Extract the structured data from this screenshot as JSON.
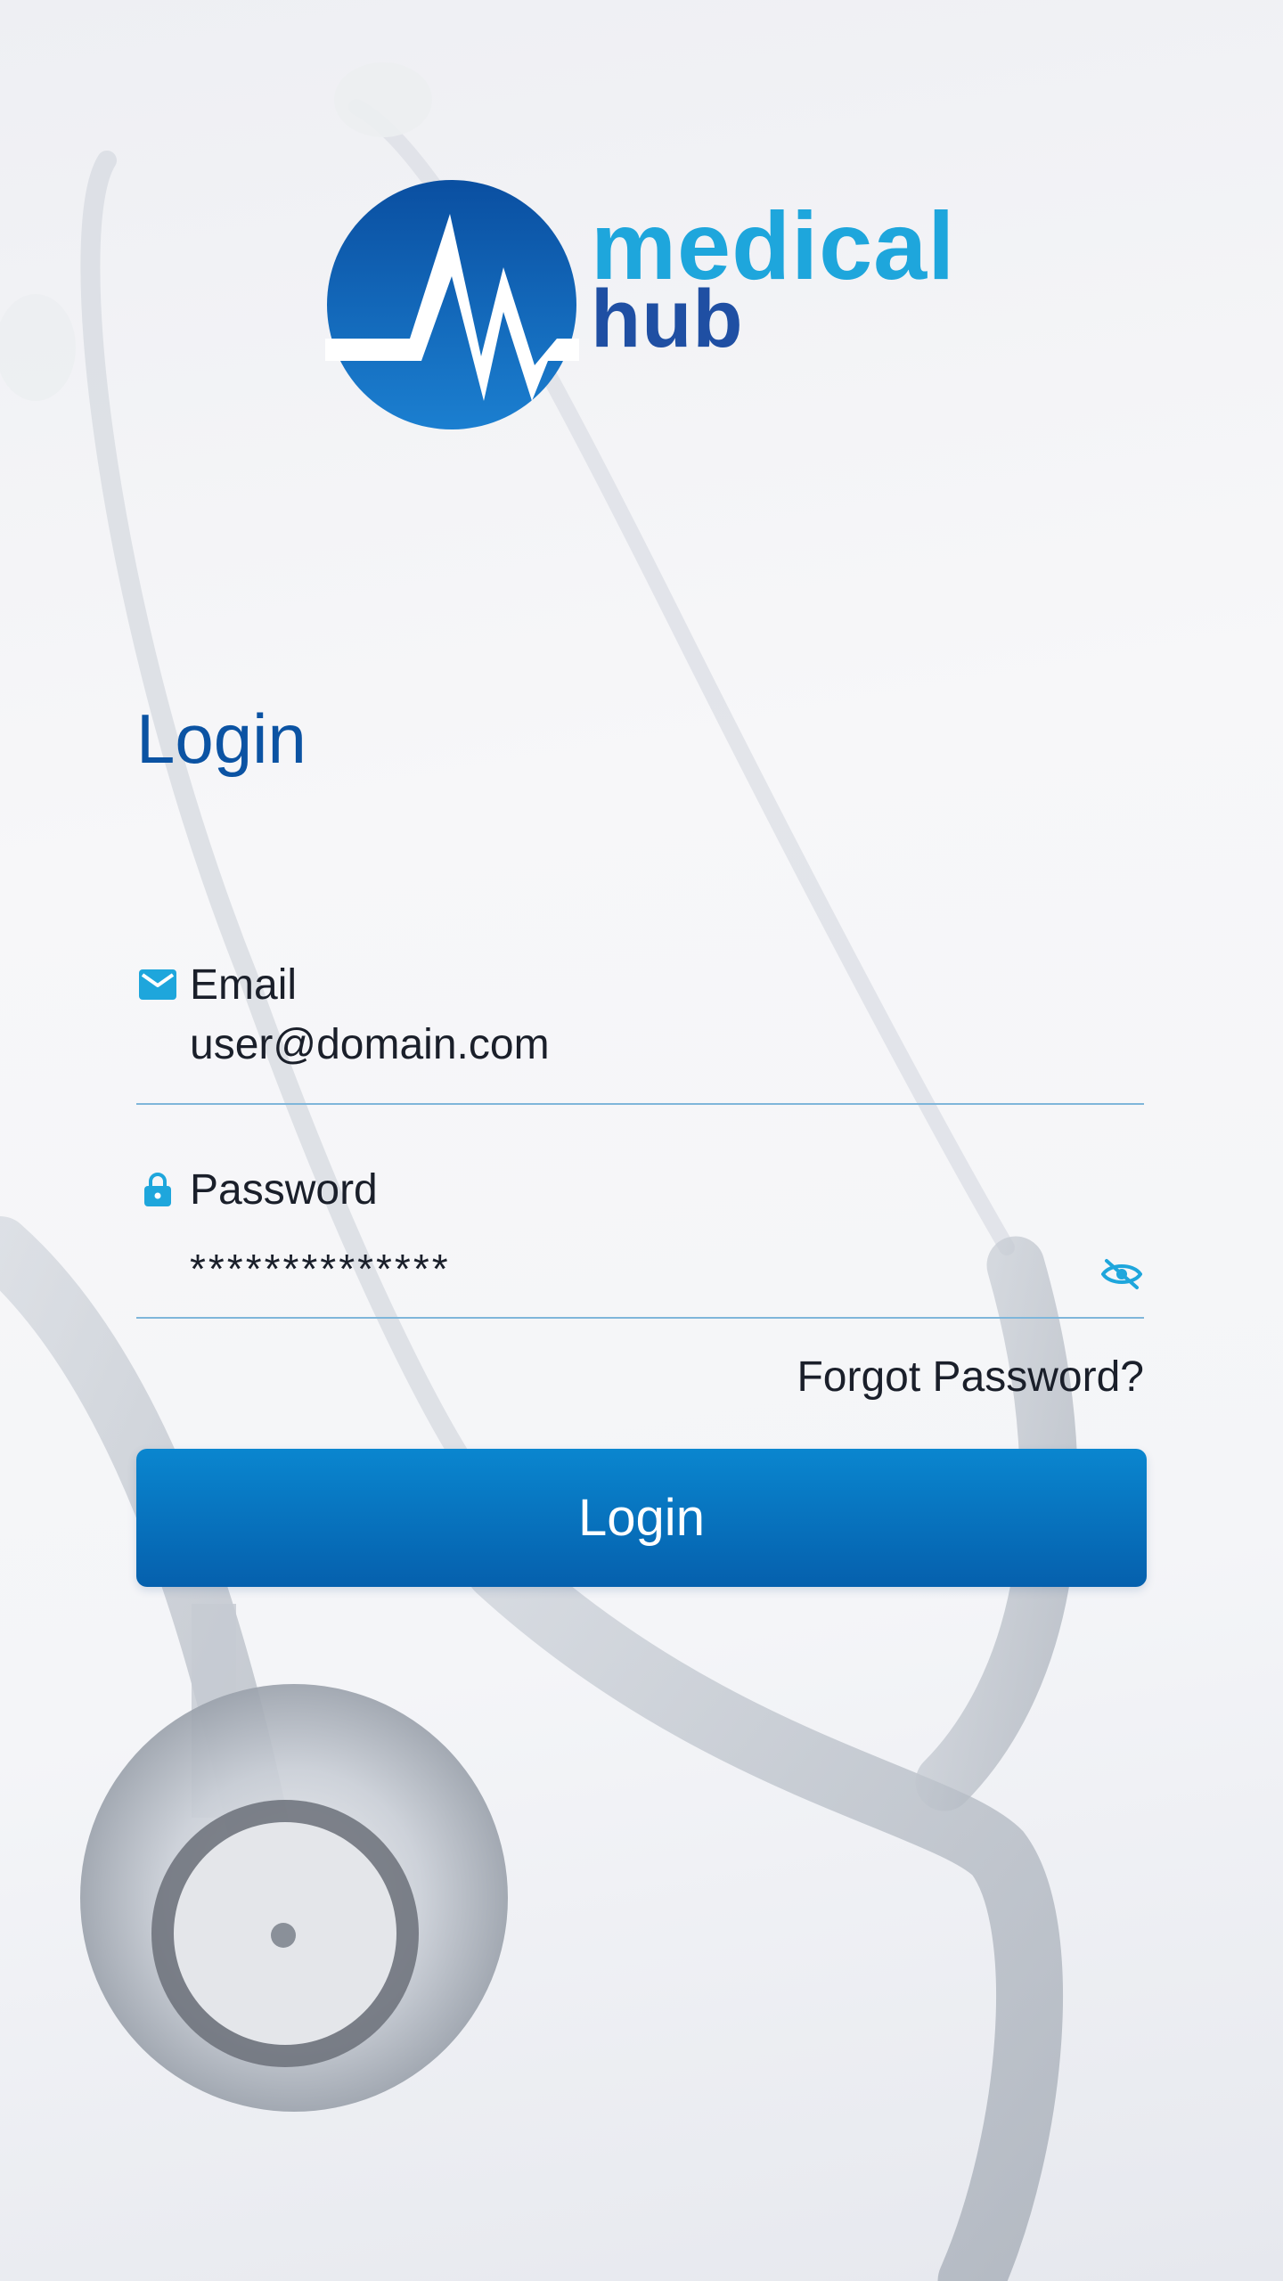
{
  "brand": {
    "word1": "medical",
    "word2": "hub",
    "colors": {
      "primary": "#0b53a3",
      "accent": "#1ea6dc",
      "dark_blue": "#1f4fa3"
    }
  },
  "login_form": {
    "title": "Login",
    "email": {
      "label": "Email",
      "value": "user@domain.com",
      "icon": "mail-icon"
    },
    "password": {
      "label": "Password",
      "value": "**************",
      "icon": "lock-icon",
      "toggle_icon": "eye-off-icon"
    },
    "forgot_password_label": "Forgot Password?",
    "submit_label": "Login"
  }
}
